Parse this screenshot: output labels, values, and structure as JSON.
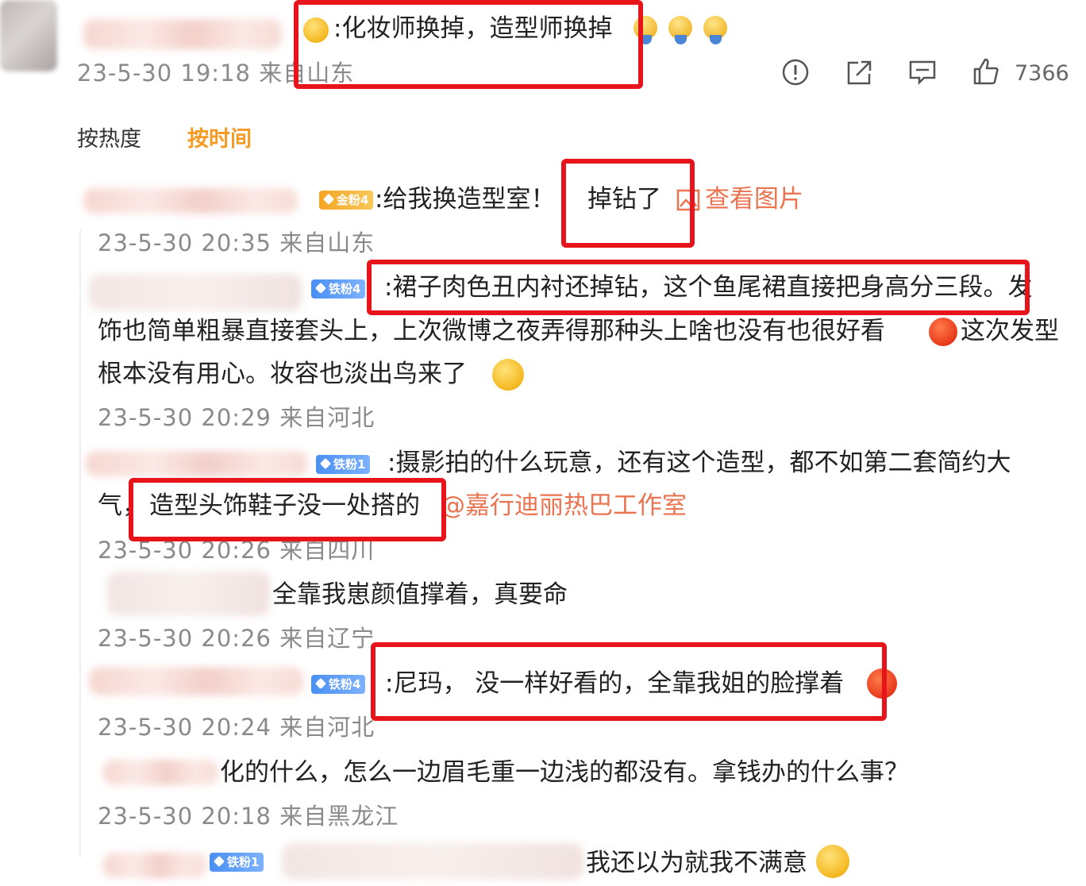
{
  "top_comment": {
    "text": ":化妆师换掉，造型师换掉",
    "meta": "23-5-30 19:18 来自山东",
    "like_count": "7366"
  },
  "sort_tabs": {
    "by_heat": "按热度",
    "by_time": "按时间"
  },
  "replies": [
    {
      "badge": "金粉4",
      "text": ":给我换造型室！",
      "text2": "掉钻了",
      "link": "查看图片",
      "meta": "23-5-30 20:35 来自山东"
    },
    {
      "badge": "铁粉4",
      "line1": ":裙子肉色丑内衬还掉钻，这个鱼尾裙直接把身高分三段。发",
      "line2": "饰也简单粗暴直接套头上，上次微博之夜弄得那种头上啥也没有也很好看",
      "line2b": "这次发型",
      "line3": "根本没有用心。妆容也淡出鸟来了",
      "meta": "23-5-30 20:29 来自河北"
    },
    {
      "badge": "铁粉1",
      "line1": ":摄影拍的什么玩意，还有这个造型，都不如第二套简约大",
      "line2a": "气，",
      "line2b": "造型头饰鞋子没一处搭的",
      "link": "@嘉行迪丽热巴工作室",
      "meta": "23-5-30 20:26 来自四川"
    },
    {
      "text": "全靠我崽颜值撑着，真要命",
      "meta": "23-5-30 20:26 来自辽宁"
    },
    {
      "badge": "铁粉4",
      "text": ":尼玛， 没一样好看的，全靠我姐的脸撑着",
      "meta": "23-5-30 20:24 来自河北"
    },
    {
      "text": "化的什么，怎么一边眉毛重一边浅的都没有。拿钱办的什么事？",
      "meta": "23-5-30 20:18 来自黑龙江"
    },
    {
      "badge": "铁粉1",
      "text": "我还以为就我不满意"
    }
  ],
  "colors": {
    "highlight_box": "#e8141c",
    "link": "#eb7350",
    "active_tab": "#f59a23",
    "meta_text": "#8a8a8a"
  },
  "icons": [
    "report-icon",
    "share-icon",
    "comment-icon",
    "like-icon"
  ]
}
